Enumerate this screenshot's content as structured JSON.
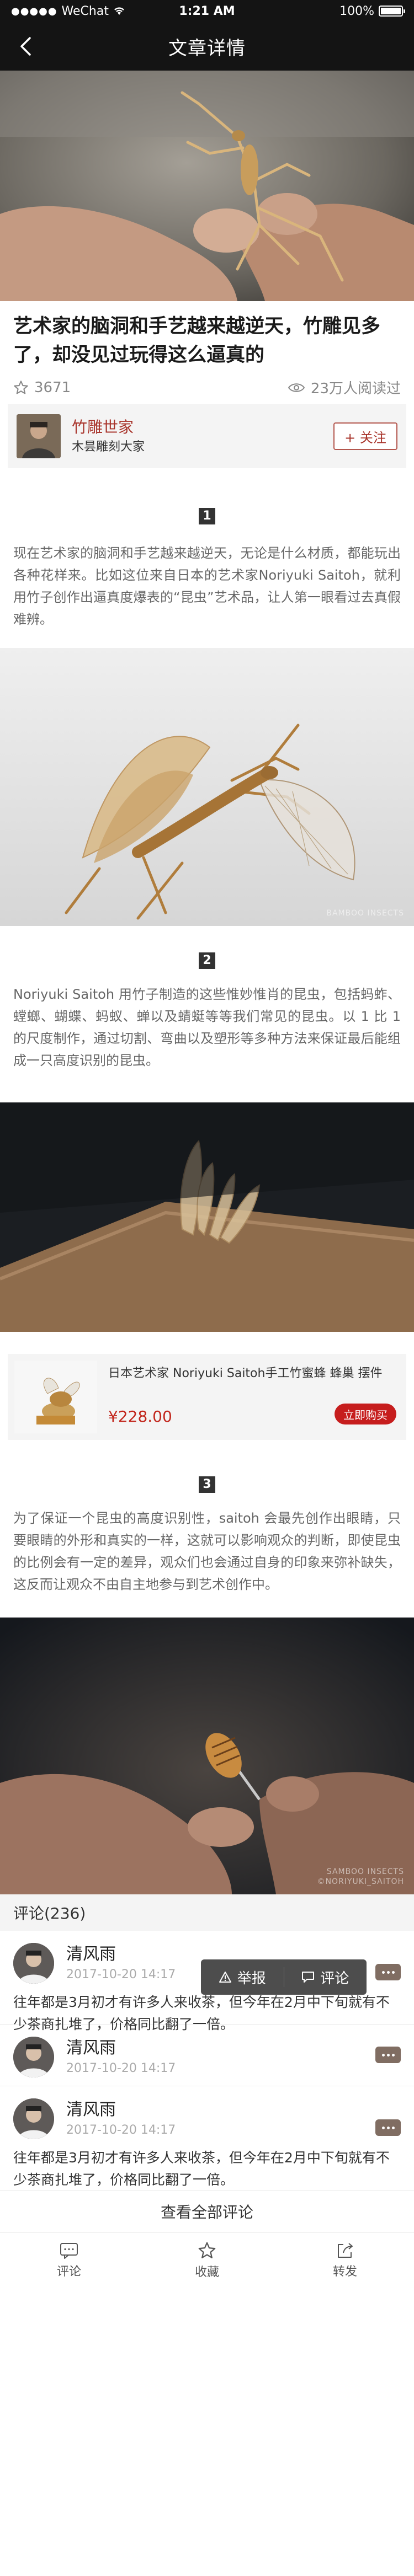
{
  "status_bar": {
    "carrier": "WeChat",
    "time": "1:21 AM",
    "battery": "100%"
  },
  "nav": {
    "title": "文章详情",
    "back_icon": "chevron-left-icon"
  },
  "article": {
    "title": "艺术家的脑洞和手艺越来越逆天，竹雕见多了，却没见过玩得这么逼真的",
    "likes": "3671",
    "reads": "23万人阅读过"
  },
  "author": {
    "name": "竹雕世家",
    "role": "木昙雕刻大家",
    "follow_label": "+ 关注"
  },
  "sections": [
    {
      "num": "1",
      "text": "现在艺术家的脑洞和手艺越来越逆天，无论是什么材质，都能玩出各种花样来。比如这位来自日本的艺术家Noriyuki Saitoh，就利用竹子创作出逼真度爆表的“昆虫”艺术品，让人第一眼看过去真假难辨。"
    },
    {
      "num": "2",
      "text": "Noriyuki Saitoh 用竹子制造的这些惟妙惟肖的昆虫，包括蚂蚱、螳螂、蝴蝶、蚂蚁、蝉以及蜻蜓等等我们常见的昆虫。以 1 比 1 的尺度制作，通过切割、弯曲以及塑形等多种方法来保证最后能组成一只高度识别的昆虫。"
    },
    {
      "num": "3",
      "text": "为了保证一个昆虫的高度识别性，saitoh 会最先创作出眼睛，只要眼睛的外形和真实的一样，这就可以影响观众的判断，即使昆虫的比例会有一定的差异，观众们也会通过自身的印象来弥补缺失，这反而让观众不由自主地参与到艺术创作中。"
    }
  ],
  "watermarks": {
    "img2": "BAMBOO INSECTS",
    "img4_line1": "SAMBOO INSECTS",
    "img4_line2": "©NORIYUKI_SAITOH"
  },
  "product": {
    "title": "日本艺术家 Noriyuki Saitoh手工竹蜜蜂 蜂巢 摆件",
    "price": "¥228.00",
    "buy_label": "立即购买"
  },
  "comments": {
    "header": "评论(236)",
    "popup": {
      "report": "举报",
      "comment": "评论"
    },
    "items": [
      {
        "name": "清风雨",
        "time": "2017-10-20 14:17",
        "text": "往年都是3月初才有许多人来收茶，但今年在2月中下旬就有不少茶商扎堆了，价格同比翻了一倍。"
      },
      {
        "name": "清风雨",
        "time": "2017-10-20 14:17",
        "text": ""
      },
      {
        "name": "清风雨",
        "time": "2017-10-20 14:17",
        "text": "往年都是3月初才有许多人来收茶，但今年在2月中下旬就有不少茶商扎堆了，价格同比翻了一倍。"
      }
    ],
    "view_all": "查看全部评论"
  },
  "tabbar": {
    "comment": "评论",
    "favorite": "收藏",
    "share": "转发"
  },
  "colors": {
    "accent": "#a8342b",
    "buy": "#c61d1d",
    "price": "#c2271d"
  }
}
